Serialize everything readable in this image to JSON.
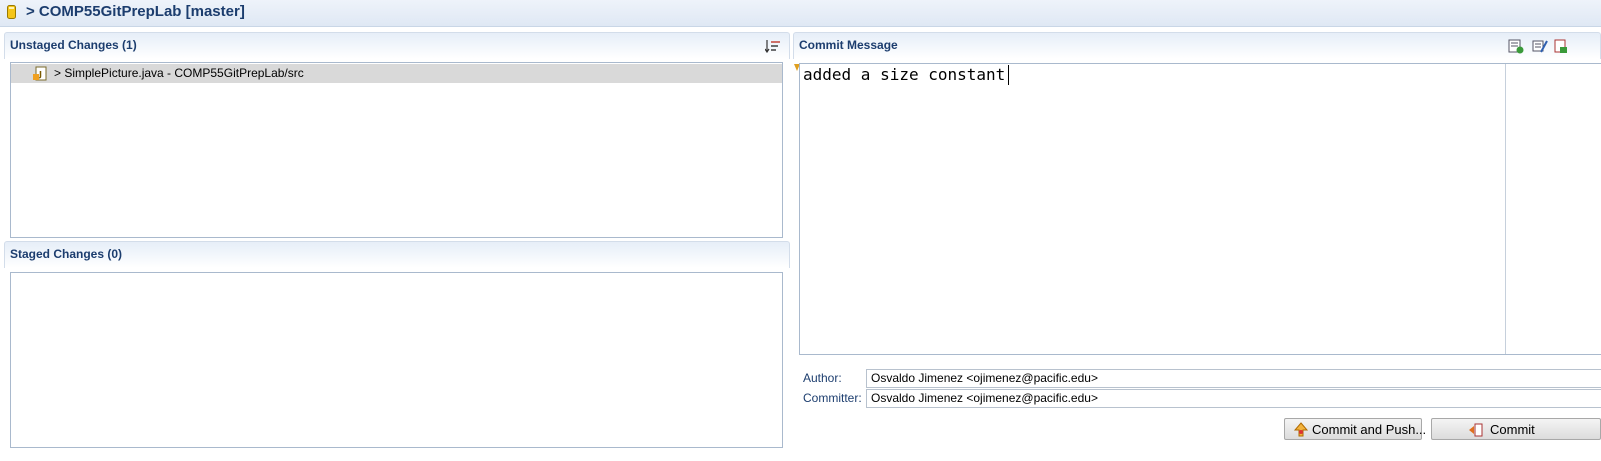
{
  "header": {
    "title": "> COMP55GitPrepLab [master]"
  },
  "unstaged": {
    "title": "Unstaged Changes (1)",
    "files": [
      {
        "label": "> SimplePicture.java - COMP55GitPrepLab/src"
      }
    ]
  },
  "staged": {
    "title": "Staged Changes (0)"
  },
  "commit": {
    "title": "Commit Message",
    "message": "added a size constant",
    "author_label": "Author:",
    "author_value": "Osvaldo Jimenez <ojimenez@pacific.edu>",
    "committer_label": "Committer:",
    "committer_value": "Osvaldo Jimenez <ojimenez@pacific.edu>",
    "commit_and_push_label": "Commit and Push...",
    "commit_label": "Commit"
  },
  "icons": {
    "repo": "repository-icon",
    "sort": "sort-icon",
    "add_signed_off": "signed-off-icon",
    "amend": "amend-icon",
    "add_change_id": "change-id-icon",
    "java_file": "java-file-icon",
    "commit_push": "commit-push-icon",
    "commit": "commit-icon"
  }
}
